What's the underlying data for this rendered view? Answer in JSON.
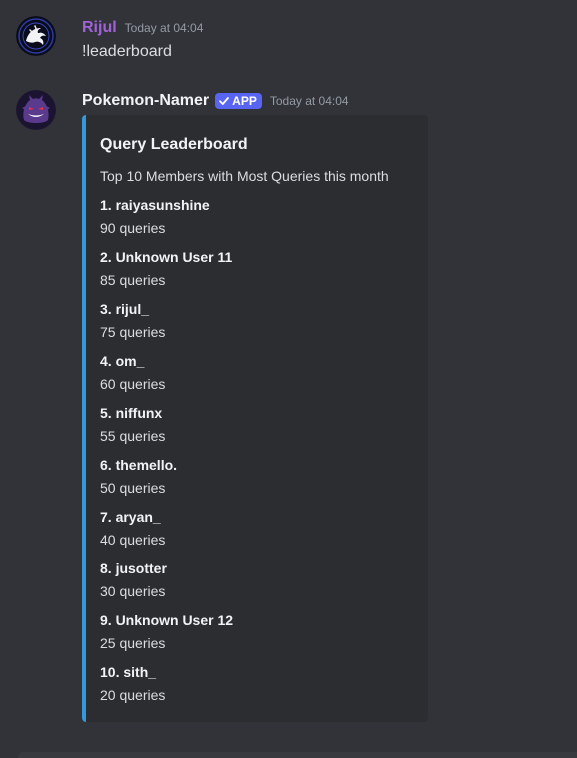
{
  "messages": [
    {
      "author": "Rijul",
      "author_color": "#a162d8",
      "timestamp": "Today at 04:04",
      "text": "!leaderboard",
      "avatar_icon": "dragon-logo-icon"
    },
    {
      "author": "Pokemon-Namer",
      "author_color": "#f2f3f5",
      "badge": "APP",
      "badge_color": "#5865f2",
      "timestamp": "Today at 04:04",
      "avatar_icon": "gengar-avatar-icon",
      "embed": {
        "accent_color": "#3498db",
        "title": "Query Leaderboard",
        "description": "Top 10 Members with Most Queries this month",
        "fields": [
          {
            "name": "1. raiyasunshine",
            "value": "90 queries"
          },
          {
            "name": "2. Unknown User 11",
            "value": "85 queries"
          },
          {
            "name": "3. rijul_",
            "value": "75 queries"
          },
          {
            "name": "4. om_",
            "value": "60 queries"
          },
          {
            "name": "5. niffunx",
            "value": "55 queries"
          },
          {
            "name": "6. themello.",
            "value": "50 queries"
          },
          {
            "name": "7. aryan_",
            "value": "40 queries"
          },
          {
            "name": "8. jusotter",
            "value": "30 queries"
          },
          {
            "name": "9. Unknown User 12",
            "value": "25 queries"
          },
          {
            "name": "10. sith_",
            "value": "20 queries"
          }
        ]
      }
    }
  ]
}
